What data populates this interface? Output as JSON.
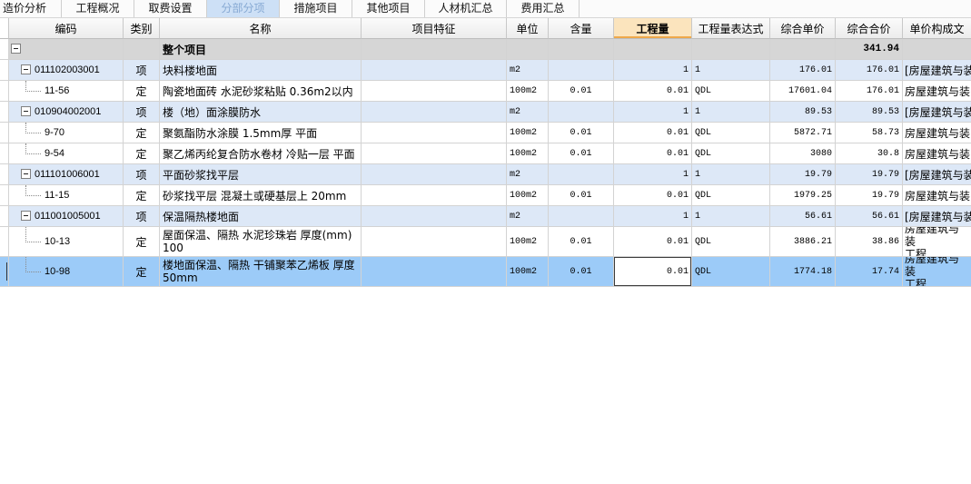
{
  "tabs": [
    {
      "label": "造价分析",
      "active": false
    },
    {
      "label": "工程概况",
      "active": false
    },
    {
      "label": "取费设置",
      "active": false
    },
    {
      "label": "分部分项",
      "active": true
    },
    {
      "label": "措施项目",
      "active": false
    },
    {
      "label": "其他项目",
      "active": false
    },
    {
      "label": "人材机汇总",
      "active": false
    },
    {
      "label": "费用汇总",
      "active": false
    }
  ],
  "columns": {
    "code": "编码",
    "type": "类别",
    "name": "名称",
    "feature": "项目特征",
    "unit": "单位",
    "content": "含量",
    "quantity": "工程量",
    "qty_expr": "工程量表达式",
    "unit_price": "综合单价",
    "total_price": "综合合价",
    "price_file": "单价构成文"
  },
  "rows": [
    {
      "name": "整个项目",
      "total_price": "341.94",
      "expanded": true
    },
    {
      "code": "011102003001",
      "type": "项",
      "name": "块料楼地面",
      "unit": "m2",
      "quantity": "1",
      "qty_expr": "1",
      "unit_price": "176.01",
      "total_price": "176.01",
      "price_file": "[房屋建筑与装",
      "expanded": true
    },
    {
      "code": "11-56",
      "type": "定",
      "name": "陶瓷地面砖 水泥砂浆粘贴 0.36m2以内",
      "unit": "100m2",
      "content": "0.01",
      "quantity": "0.01",
      "qty_expr": "QDL",
      "unit_price": "17601.04",
      "total_price": "176.01",
      "price_file": "房屋建筑与装"
    },
    {
      "code": "010904002001",
      "type": "项",
      "name": "楼（地）面涂膜防水",
      "unit": "m2",
      "quantity": "1",
      "qty_expr": "1",
      "unit_price": "89.53",
      "total_price": "89.53",
      "price_file": "[房屋建筑与装",
      "expanded": true
    },
    {
      "code": "9-70",
      "type": "定",
      "name": "聚氨酯防水涂膜 1.5mm厚 平面",
      "unit": "100m2",
      "content": "0.01",
      "quantity": "0.01",
      "qty_expr": "QDL",
      "unit_price": "5872.71",
      "total_price": "58.73",
      "price_file": "房屋建筑与装"
    },
    {
      "code": "9-54",
      "type": "定",
      "name": "聚乙烯丙纶复合防水卷材 冷贴一层 平面",
      "unit": "100m2",
      "content": "0.01",
      "quantity": "0.01",
      "qty_expr": "QDL",
      "unit_price": "3080",
      "total_price": "30.8",
      "price_file": "房屋建筑与装"
    },
    {
      "code": "011101006001",
      "type": "项",
      "name": "平面砂浆找平层",
      "unit": "m2",
      "quantity": "1",
      "qty_expr": "1",
      "unit_price": "19.79",
      "total_price": "19.79",
      "price_file": "[房屋建筑与装",
      "expanded": true
    },
    {
      "code": "11-15",
      "type": "定",
      "name": "砂浆找平层 混凝土或硬基层上 20mm",
      "unit": "100m2",
      "content": "0.01",
      "quantity": "0.01",
      "qty_expr": "QDL",
      "unit_price": "1979.25",
      "total_price": "19.79",
      "price_file": "房屋建筑与装"
    },
    {
      "code": "011001005001",
      "type": "项",
      "name": "保温隔热楼地面",
      "unit": "m2",
      "quantity": "1",
      "qty_expr": "1",
      "unit_price": "56.61",
      "total_price": "56.61",
      "price_file": "[房屋建筑与装",
      "expanded": true
    },
    {
      "code": "10-13",
      "type": "定",
      "name": "屋面保温、隔热 水泥珍珠岩 厚度(mm)\n100",
      "unit": "100m2",
      "content": "0.01",
      "quantity": "0.01",
      "qty_expr": "QDL",
      "unit_price": "3886.21",
      "total_price": "38.86",
      "price_file": "房屋建筑与装\n工程"
    },
    {
      "code": "10-98",
      "type": "定",
      "name": "楼地面保温、隔热 干铺聚苯乙烯板 厚度\n50mm",
      "unit": "100m2",
      "content": "0.01",
      "quantity": "0.01",
      "qty_expr": "QDL",
      "unit_price": "1774.18",
      "total_price": "17.74",
      "price_file": "房屋建筑与装\n工程",
      "selected": true,
      "quantity_editing": true
    }
  ],
  "icons": {
    "toggle": "collapse-box-icon"
  },
  "colors": {
    "active_tab_bg": "#cde0f6",
    "active_tab_text": "#86a9d3",
    "root_row_bg": "#d6d6d6",
    "bill_item_row_bg": "#dde8f7",
    "selected_row_bg": "#9ccbf8",
    "focused_header_bg": "#fbe4bd",
    "focused_header_line": "#eea84a",
    "grid_line": "#d3d3d3"
  }
}
